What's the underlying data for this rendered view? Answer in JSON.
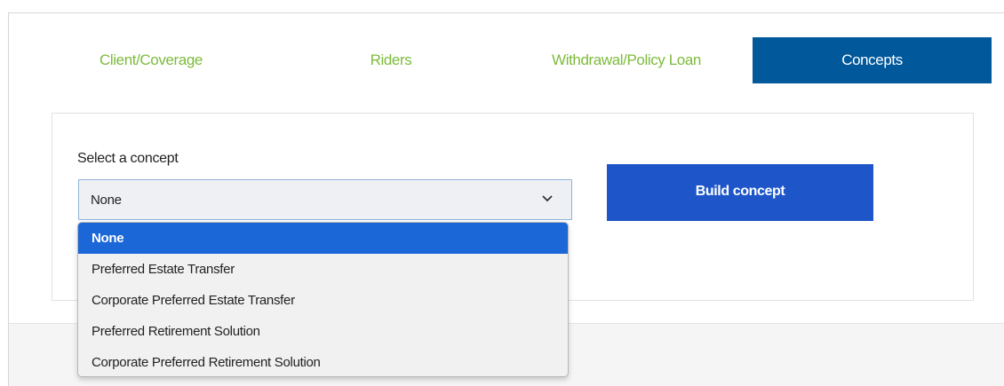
{
  "tabs": {
    "client_coverage": "Client/Coverage",
    "riders": "Riders",
    "withdrawal": "Withdrawal/Policy Loan",
    "concepts": "Concepts"
  },
  "concept_form": {
    "label": "Select a concept",
    "selected_value": "None",
    "build_button": "Build concept",
    "options": [
      "None",
      "Preferred Estate Transfer",
      "Corporate Preferred Estate Transfer",
      "Preferred Retirement Solution",
      "Corporate Preferred Retirement Solution"
    ]
  },
  "colors": {
    "tab_text": "#7dbb3c",
    "active_tab": "#01589b",
    "build_button": "#1e56c9",
    "option_highlight": "#1c67d8"
  },
  "icons": {
    "select_arrow": "chevron-down-icon"
  }
}
